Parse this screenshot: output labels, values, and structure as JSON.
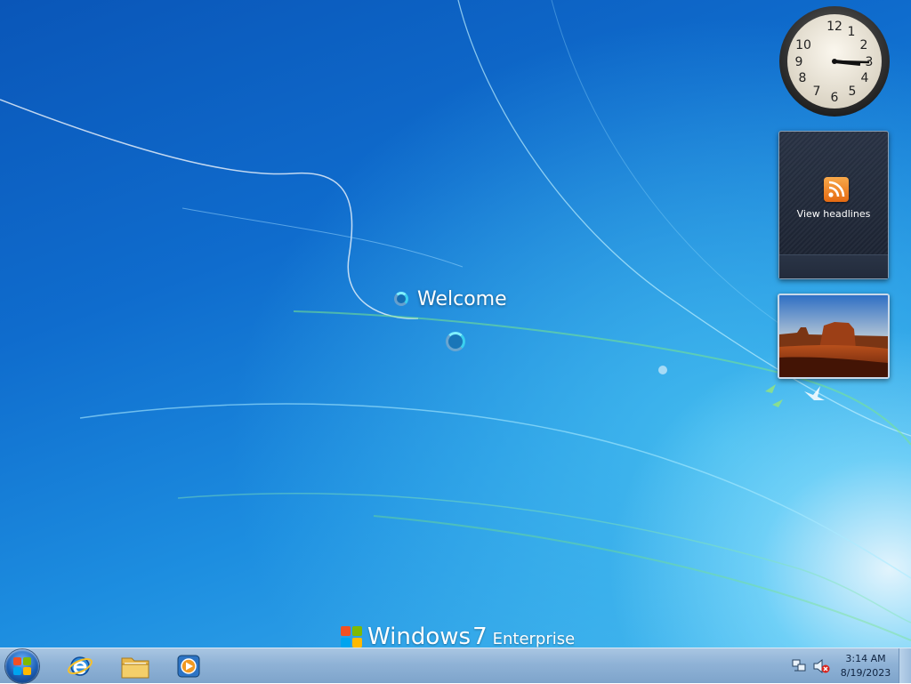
{
  "logon": {
    "status_text": "Welcome"
  },
  "branding": {
    "product": "Windows",
    "version": "7",
    "edition": "Enterprise"
  },
  "gadgets": {
    "clock": {
      "numerals": [
        "12",
        "1",
        "2",
        "3",
        "4",
        "5",
        "6",
        "7",
        "8",
        "9",
        "10"
      ],
      "time_shown": "3:14"
    },
    "feed_headlines": {
      "label": "View headlines",
      "icon": "rss-icon"
    },
    "slideshow": {
      "icon": "desert-landscape-image"
    }
  },
  "taskbar": {
    "start_icon": "windows-logo-icon",
    "pinned": [
      {
        "name": "Internet Explorer",
        "icon": "ie-icon"
      },
      {
        "name": "Windows Explorer",
        "icon": "folder-icon"
      },
      {
        "name": "Windows Media Player",
        "icon": "media-player-icon"
      }
    ],
    "tray": {
      "network_icon": "network-icon",
      "volume_icon": "volume-muted-icon",
      "time": "3:14 AM",
      "date": "8/19/2023"
    }
  },
  "colors": {
    "desktop_blue": "#0f6ccd",
    "taskbar": "#8fb2d6",
    "rss_orange": "#e56a12"
  }
}
